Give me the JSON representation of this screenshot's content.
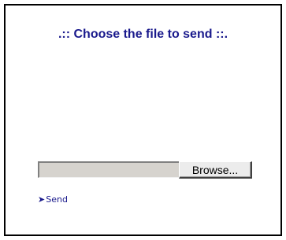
{
  "panel": {
    "title": ".:: Choose the file to send ::."
  },
  "upload": {
    "file_path_value": "",
    "browse_label": "Browse..."
  },
  "actions": {
    "send_arrow": "➤",
    "send_label": "Send"
  },
  "colors": {
    "title_color": "#1a1a8c",
    "link_color": "#1a1a8c",
    "border_color": "#000000",
    "file_field_bg": "#d6d3ce"
  }
}
